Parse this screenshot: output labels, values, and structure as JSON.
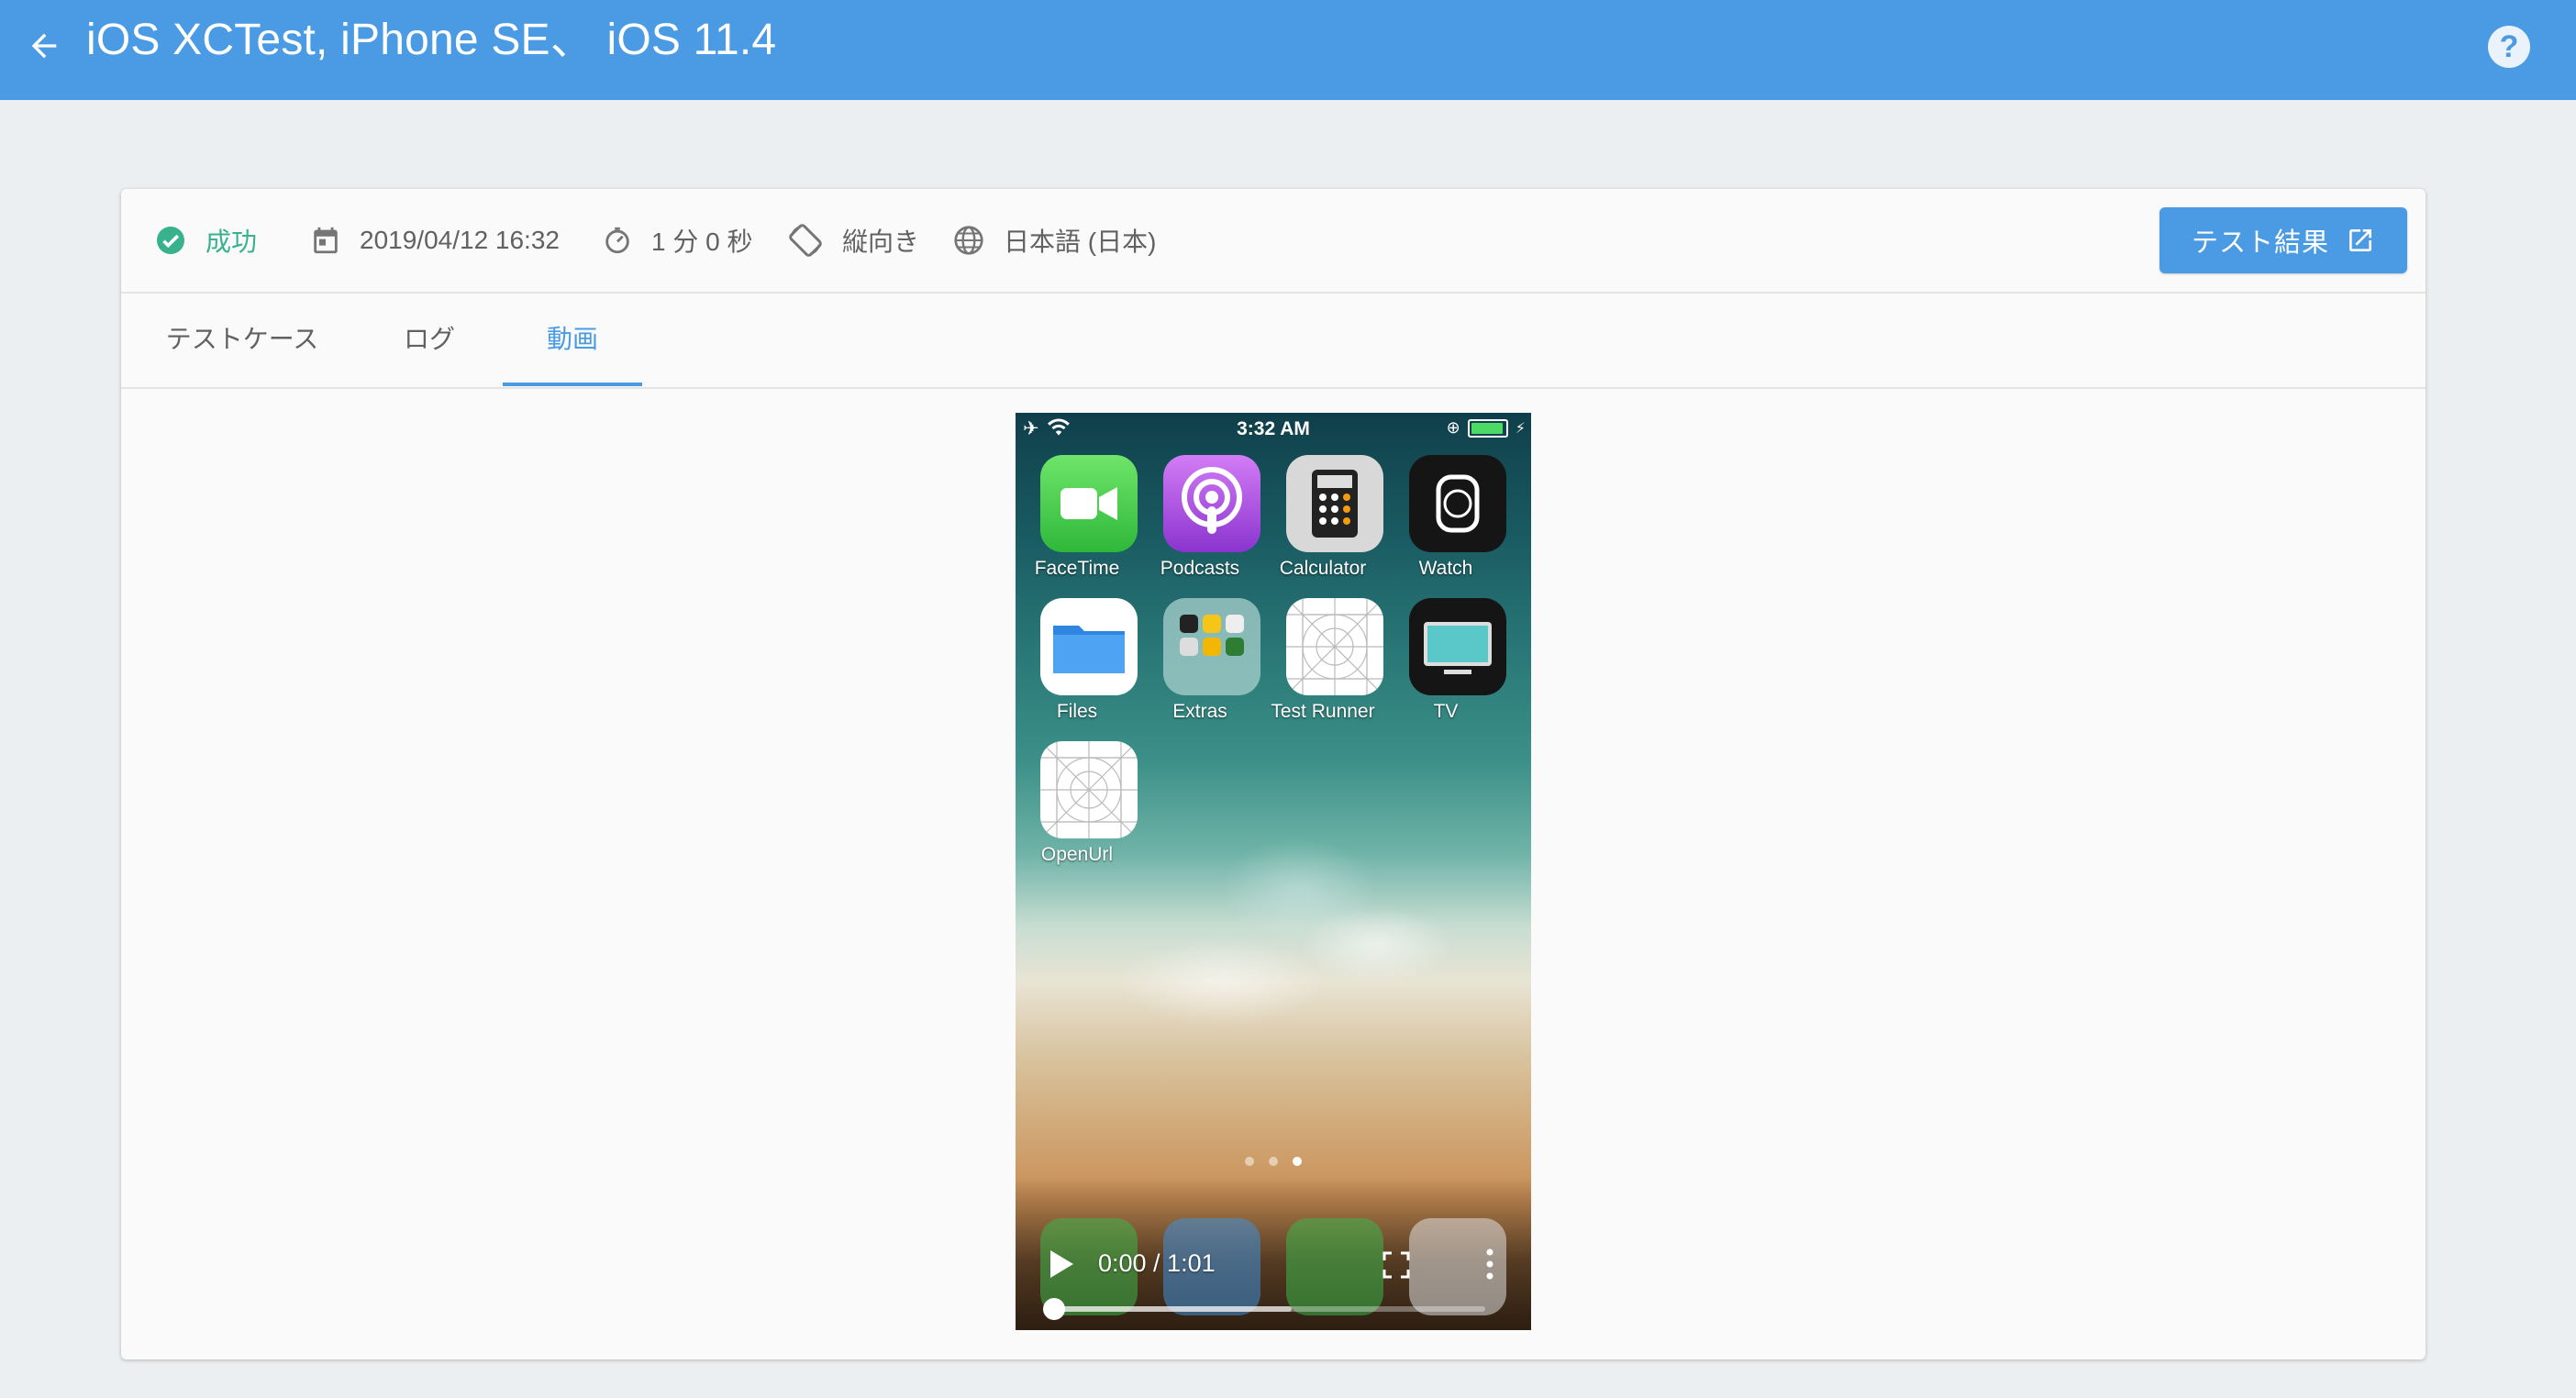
{
  "header": {
    "title": "iOS XCTest, iPhone SE、 iOS 11.4",
    "back_icon": "arrow-left-icon",
    "help_icon": "help-circle-icon",
    "bar_color": "#4a9be3"
  },
  "summary": {
    "status": "成功",
    "status_color": "#38b28c",
    "date": "2019/04/12 16:32",
    "duration": "1 分 0 秒",
    "orientation": "縦向き",
    "locale": "日本語 (日本)",
    "result_button": "テスト結果"
  },
  "tabs": [
    {
      "label": "テストケース",
      "active": false
    },
    {
      "label": "ログ",
      "active": false
    },
    {
      "label": "動画",
      "active": true
    }
  ],
  "video": {
    "status_time": "3:32 AM",
    "apps": [
      {
        "label": "FaceTime",
        "icon": "facetime-icon"
      },
      {
        "label": "Podcasts",
        "icon": "podcasts-icon"
      },
      {
        "label": "Calculator",
        "icon": "calculator-icon"
      },
      {
        "label": "Watch",
        "icon": "watch-icon"
      },
      {
        "label": "Files",
        "icon": "files-icon"
      },
      {
        "label": "Extras",
        "icon": "extras-folder-icon"
      },
      {
        "label": "Test Runner",
        "icon": "test-runner-icon"
      },
      {
        "label": "TV",
        "icon": "tv-icon"
      },
      {
        "label": "OpenUrl",
        "icon": "openurl-icon"
      }
    ],
    "page_dots": 3,
    "active_page": 3,
    "current_time": "0:00",
    "total_time": "1:01",
    "time_display": "0:00 / 1:01",
    "progress": 0.0,
    "buffered": 0.55
  }
}
